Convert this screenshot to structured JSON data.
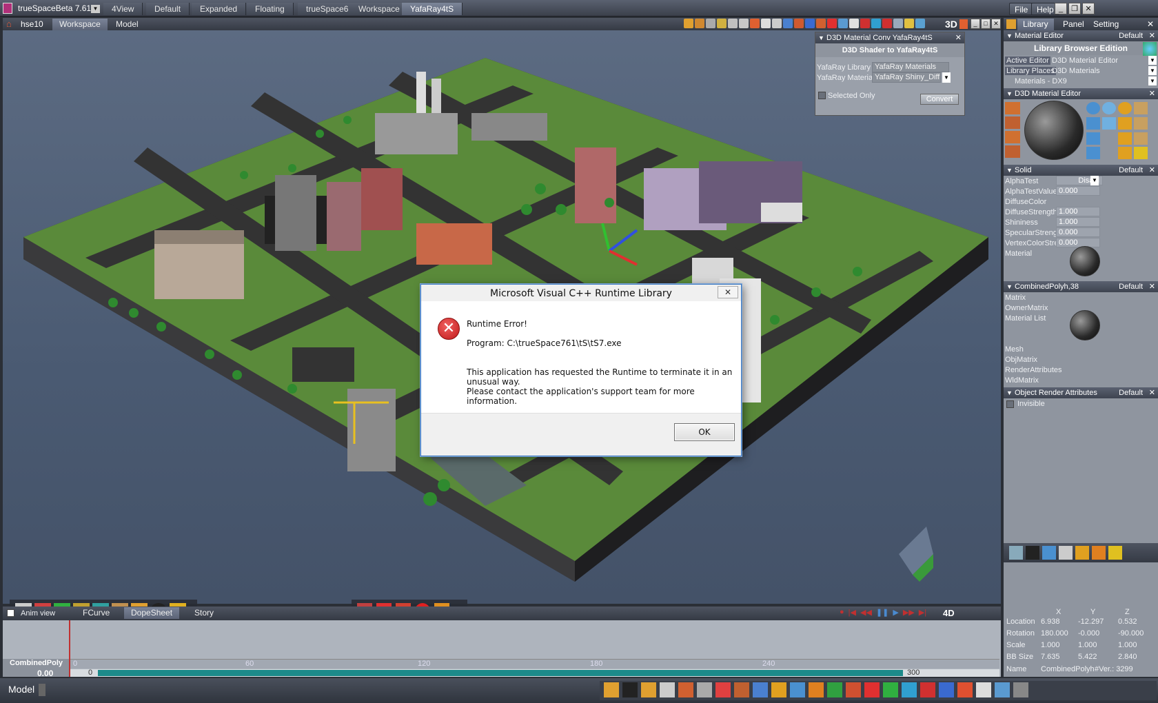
{
  "app": {
    "title": "trueSpaceBeta 7.61",
    "layouts": [
      "4View",
      "Default",
      "Expanded",
      "Floating",
      "trueSpace6",
      "Workspace",
      "YafaRay4tS"
    ],
    "active_layout": "YafaRay4tS",
    "menu_file": "File",
    "menu_help": "Help"
  },
  "viewport": {
    "scene": "hse10",
    "tabs": [
      "Workspace",
      "Model"
    ],
    "active_tab": "Workspace",
    "mode": "3D"
  },
  "conv_panel": {
    "title": "D3D Material Conv YafaRay4tS",
    "subtitle": "D3D Shader to YafaRay4tS",
    "library_label": "YafaRay Library",
    "library_value": "YafaRay Materials",
    "material_label": "YafaRay Material",
    "material_value": "YafaRay Shiny_Diffu",
    "selected_only": "Selected Only",
    "convert": "Convert"
  },
  "right_panel": {
    "tabs": [
      "Library",
      "Panel",
      "Setting"
    ],
    "material_editor": {
      "title": "Material Editor",
      "default": "Default",
      "edition": "Library Browser Edition",
      "active_editor_label": "Active Editor",
      "active_editor_value": "D3D Material Editor",
      "library_places_label": "Library Places",
      "library_places_value": "D3D Materials",
      "materials": "Materials - DX9"
    },
    "d3d_editor": {
      "title": "D3D Material Editor"
    },
    "solid": {
      "title": "Solid",
      "default": "Default",
      "rows": [
        {
          "label": "AlphaTest",
          "value": "Disabl"
        },
        {
          "label": "AlphaTestValue",
          "value": "0.000"
        },
        {
          "label": "DiffuseColor",
          "value": ""
        },
        {
          "label": "DiffuseStrength",
          "value": "1.000"
        },
        {
          "label": "Shininess",
          "value": "1.000"
        },
        {
          "label": "SpecularStrengt",
          "value": "0.000"
        },
        {
          "label": "VertexColorStre",
          "value": "0.000"
        },
        {
          "label": "Material",
          "value": ""
        }
      ]
    },
    "combined": {
      "title": "CombinedPolyh,38",
      "default": "Default",
      "items": [
        "Matrix",
        "OwnerMatrix",
        "Material List",
        "Mesh",
        "ObjMatrix",
        "RenderAttributes",
        "WldMatrix"
      ]
    },
    "object_render": {
      "title": "Object Render Attributes",
      "default": "Default",
      "invisible": "Invisible"
    }
  },
  "anim": {
    "checkbox_label": "Anim view",
    "tabs": [
      "FCurve",
      "DopeSheet",
      "Story"
    ],
    "active_tab": "DopeSheet",
    "mode": "4D",
    "object": "CombinedPoly",
    "time": "0.00",
    "ticks": [
      "0",
      "60",
      "120",
      "180",
      "240"
    ],
    "start": "0",
    "end": "300"
  },
  "transform": {
    "headers": [
      "X",
      "Y",
      "Z"
    ],
    "rows": [
      {
        "label": "Location",
        "x": "6.938",
        "y": "-12.297",
        "z": "0.532"
      },
      {
        "label": "Rotation",
        "x": "180.000",
        "y": "-0.000",
        "z": "-90.000"
      },
      {
        "label": "Scale",
        "x": "1.000",
        "y": "1.000",
        "z": "1.000"
      },
      {
        "label": "BB Size",
        "x": "7.635",
        "y": "5.422",
        "z": "2.840"
      }
    ],
    "name_label": "Name",
    "name_value": "CombinedPolyh",
    "ver": "#Ver.: 3299"
  },
  "status": {
    "mode": "Model"
  },
  "dialog": {
    "title": "Microsoft Visual C++ Runtime Library",
    "error": "Runtime Error!",
    "program": "Program: C:\\trueSpace761\\tS\\tS7.exe",
    "message1": "This application has requested the Runtime to terminate it in an",
    "message2": "unusual way.",
    "message3": "Please contact the application's support team for more information.",
    "ok": "OK",
    "close": "✕"
  }
}
